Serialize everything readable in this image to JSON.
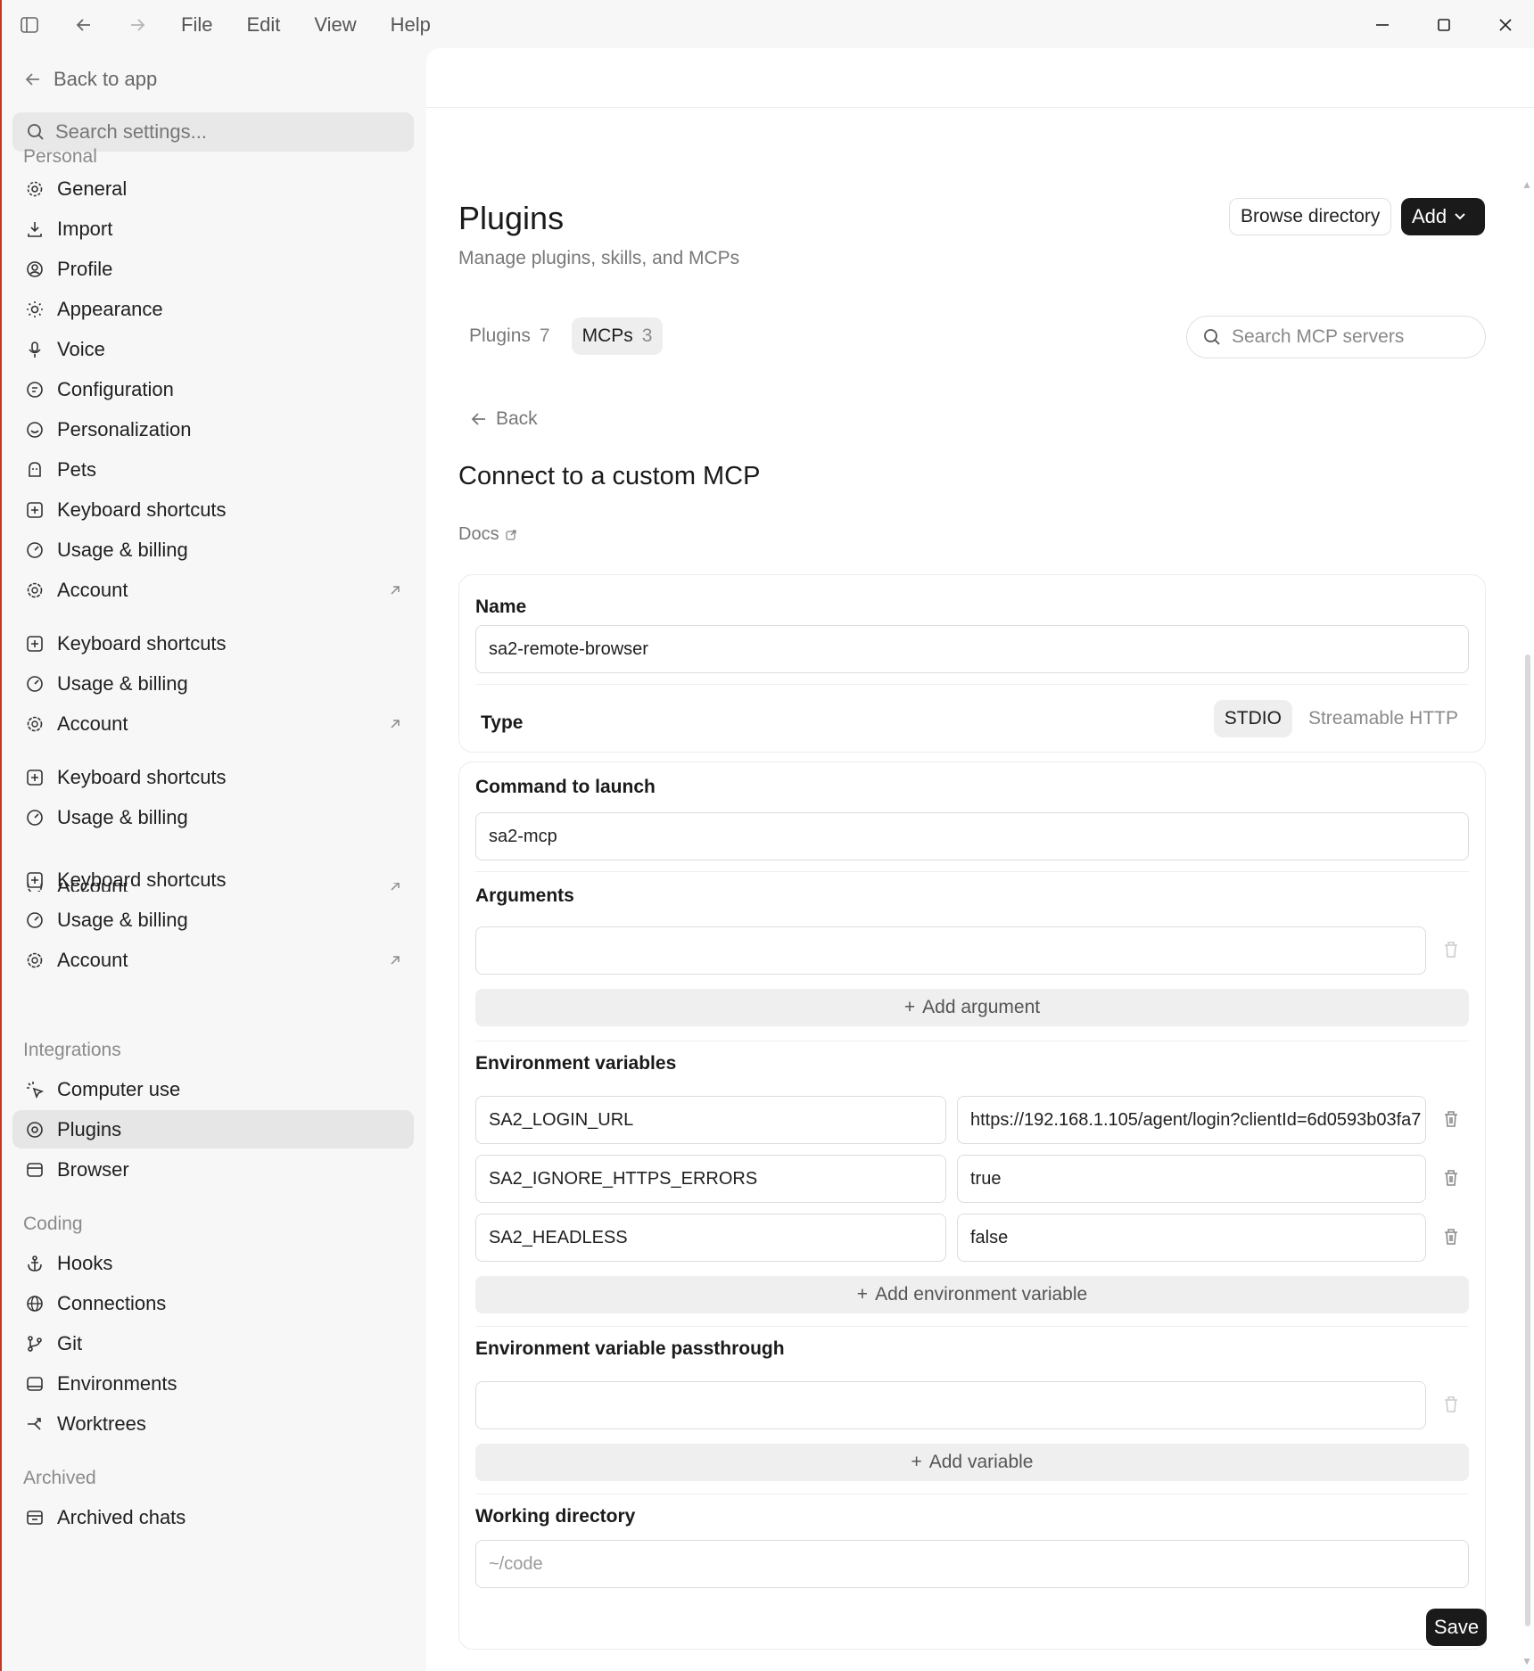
{
  "titlebar": {
    "menu": [
      "File",
      "Edit",
      "View",
      "Help"
    ]
  },
  "sidebar": {
    "back_label": "Back to app",
    "search_placeholder": "Search settings...",
    "sections": {
      "personal": "Personal",
      "integrations": "Integrations",
      "coding": "Coding",
      "archived": "Archived"
    },
    "items": {
      "general": "General",
      "import": "Import",
      "profile": "Profile",
      "appearance": "Appearance",
      "voice": "Voice",
      "configuration": "Configuration",
      "personalization": "Personalization",
      "pets": "Pets",
      "keyboard_shortcuts": "Keyboard shortcuts",
      "usage_billing": "Usage & billing",
      "account": "Account",
      "computer_use": "Computer use",
      "plugins": "Plugins",
      "browser": "Browser",
      "hooks": "Hooks",
      "connections": "Connections",
      "git": "Git",
      "environments": "Environments",
      "worktrees": "Worktrees",
      "archived_chats": "Archived chats"
    }
  },
  "header": {
    "title": "Plugins",
    "subtitle": "Manage plugins, skills, and MCPs",
    "browse_label": "Browse directory",
    "add_label": "Add"
  },
  "tabs": [
    {
      "label": "Plugins",
      "count": "7"
    },
    {
      "label": "MCPs",
      "count": "3"
    }
  ],
  "search_mcp_placeholder": "Search MCP servers",
  "form": {
    "back_label": "Back",
    "title": "Connect to a custom MCP",
    "docs_label": "Docs",
    "name_label": "Name",
    "name_value": "sa2-remote-browser",
    "type_label": "Type",
    "type_options": [
      "STDIO",
      "Streamable HTTP"
    ],
    "type_selected": "STDIO",
    "command_label": "Command to launch",
    "command_value": "sa2-mcp",
    "arguments_label": "Arguments",
    "argument_value": "",
    "add_argument_label": "Add argument",
    "env_label": "Environment variables",
    "env": [
      {
        "key": "SA2_LOGIN_URL",
        "value": "https://192.168.1.105/agent/login?clientId=6d0593b03fa7"
      },
      {
        "key": "SA2_IGNORE_HTTPS_ERRORS",
        "value": "true"
      },
      {
        "key": "SA2_HEADLESS",
        "value": "false"
      }
    ],
    "add_env_label": "Add environment variable",
    "passthrough_label": "Environment variable passthrough",
    "passthrough_value": "",
    "add_variable_label": "Add variable",
    "workdir_label": "Working directory",
    "workdir_placeholder": "~/code",
    "save_label": "Save"
  },
  "colors": {
    "accent_dark": "#1a1a1a",
    "active_bg": "#e6e6e6",
    "window_edge": "#c0392b"
  }
}
